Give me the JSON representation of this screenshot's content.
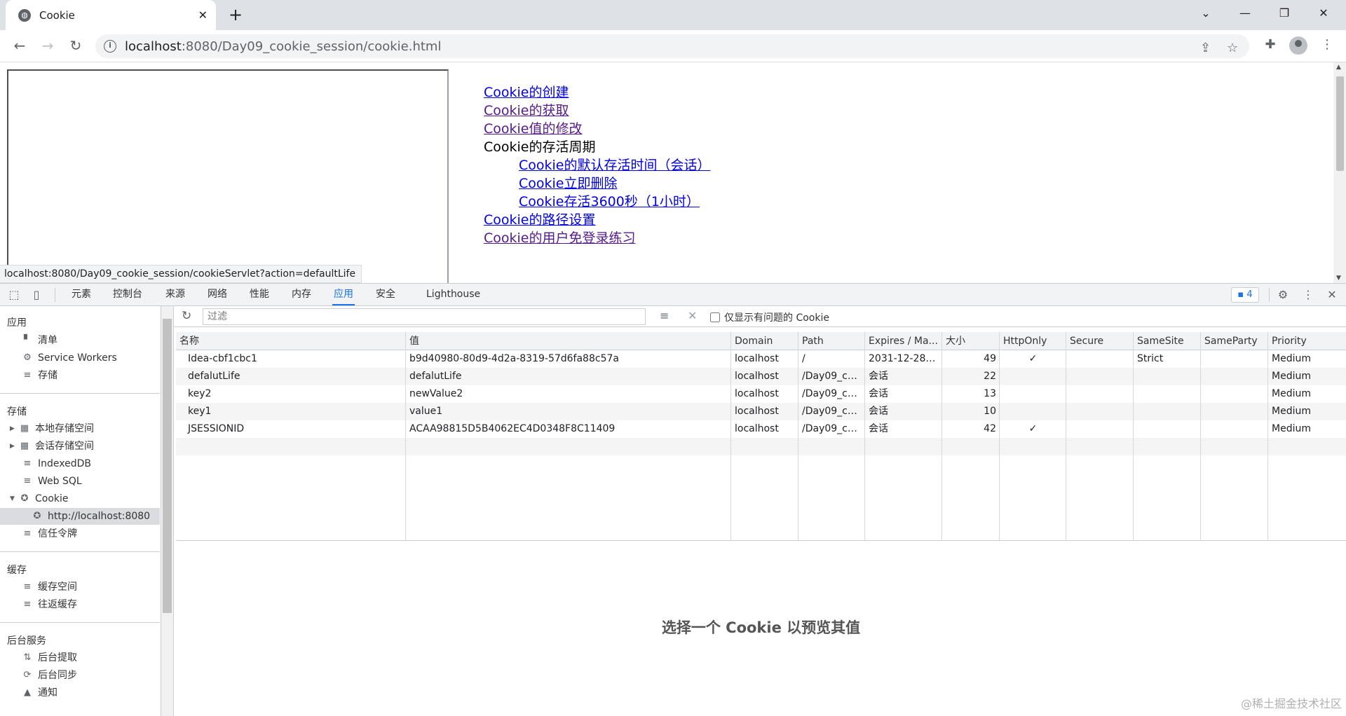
{
  "browser": {
    "tab_title": "Cookie",
    "new_tab_label": "+",
    "url_host": "localhost",
    "url_path": ":8080/Day09_cookie_session/cookie.html"
  },
  "page": {
    "menu": {
      "create": "Cookie的创建",
      "get": "Cookie的获取",
      "modify": "Cookie值的修改",
      "lifecycle": "Cookie的存活周期",
      "default_life": "Cookie的默认存活时间（会话）",
      "delete_now": "Cookie立即删除",
      "live_3600": "Cookie存活3600秒（1小时）",
      "path": "Cookie的路径设置",
      "login": "Cookie的用户免登录练习"
    },
    "status_url": "localhost:8080/Day09_cookie_session/cookieServlet?action=defaultLife"
  },
  "devtools": {
    "tabs": [
      "元素",
      "控制台",
      "来源",
      "网络",
      "性能",
      "内存",
      "应用",
      "安全",
      "Lighthouse"
    ],
    "active_tab": "应用",
    "issues_count": "4",
    "sidebar": {
      "sec_app": "应用",
      "manifest": "清单",
      "service_workers": "Service Workers",
      "storage_item": "存储",
      "sec_storage": "存储",
      "local_storage": "本地存储空间",
      "session_storage": "会话存储空间",
      "indexeddb": "IndexedDB",
      "websql": "Web SQL",
      "cookie": "Cookie",
      "cookie_origin": "http://localhost:8080",
      "trust_tokens": "信任令牌",
      "sec_cache": "缓存",
      "cache_storage": "缓存空间",
      "bfcache": "往返缓存",
      "sec_bg": "后台服务",
      "bg_fetch": "后台提取",
      "bg_sync": "后台同步",
      "notifications": "通知"
    },
    "filter_placeholder": "过滤",
    "only_issues_label": "仅显示有问题的 Cookie",
    "columns": [
      "名称",
      "值",
      "Domain",
      "Path",
      "Expires / Ma...",
      "大小",
      "HttpOnly",
      "Secure",
      "SameSite",
      "SameParty",
      "Priority"
    ],
    "rows": [
      [
        "Idea-cbf1cbc1",
        "b9d40980-80d9-4d2a-8319-57d6fa88c57a",
        "localhost",
        "/",
        "2031-12-28T...",
        "49",
        "✓",
        "",
        "Strict",
        "",
        "Medium"
      ],
      [
        "defalutLife",
        "defalutLife",
        "localhost",
        "/Day09_co...",
        "会话",
        "22",
        "",
        "",
        "",
        "",
        "Medium"
      ],
      [
        "key2",
        "newValue2",
        "localhost",
        "/Day09_co...",
        "会话",
        "13",
        "",
        "",
        "",
        "",
        "Medium"
      ],
      [
        "key1",
        "value1",
        "localhost",
        "/Day09_co...",
        "会话",
        "10",
        "",
        "",
        "",
        "",
        "Medium"
      ],
      [
        "JSESSIONID",
        "ACAA98815D5B4062EC4D0348F8C11409",
        "localhost",
        "/Day09_co...",
        "会话",
        "42",
        "✓",
        "",
        "",
        "",
        "Medium"
      ]
    ],
    "preview_text": "选择一个 Cookie 以预览其值"
  },
  "watermark": "@稀土掘金技术社区"
}
